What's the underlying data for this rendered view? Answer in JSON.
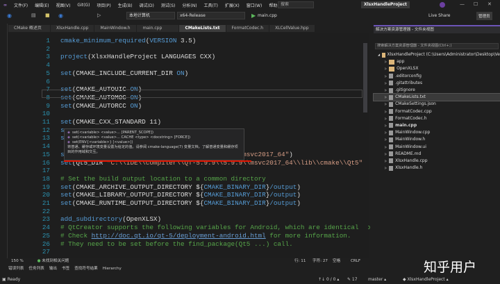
{
  "menu": [
    "文件(F)",
    "编辑(E)",
    "视图(V)",
    "Git(G)",
    "项目(P)",
    "生成(B)",
    "调试(D)",
    "测试(S)",
    "分析(N)",
    "工具(T)",
    "扩展(X)",
    "窗口(W)",
    "帮助(H)"
  ],
  "search_label": "搜索",
  "window_title": "XlsxHandleProject",
  "toolbar": {
    "target": "本地计算机",
    "config": "x64-Release",
    "run_target": "main.cpp",
    "live_share": "Live Share",
    "admin": "管理员"
  },
  "tabs": [
    "CMake 概述页",
    "XlsxHandle.cpp",
    "MainWindow.h",
    "main.cpp",
    "CMakeLists.txt",
    "FormatCodec.h",
    "XLCellValue.hpp"
  ],
  "code": [
    {
      "n": "1",
      "parts": [
        [
          "fn",
          "cmake_minimum_required"
        ],
        [
          "",
          "("
        ],
        [
          "kw",
          "VERSION"
        ],
        [
          "",
          " 3.5)"
        ]
      ]
    },
    {
      "n": "2",
      "parts": []
    },
    {
      "n": "3",
      "parts": [
        [
          "kw",
          "project"
        ],
        [
          "",
          "(XlsxHandleProject LANGUAGES CXX)"
        ]
      ]
    },
    {
      "n": "4",
      "parts": []
    },
    {
      "n": "5",
      "parts": [
        [
          "kw",
          "set"
        ],
        [
          "",
          "(CMAKE_INCLUDE_CURRENT_DIR "
        ],
        [
          "kw",
          "ON"
        ],
        [
          "",
          ")"
        ]
      ]
    },
    {
      "n": "6",
      "parts": []
    },
    {
      "n": "7",
      "parts": [
        [
          "kw",
          "set"
        ],
        [
          "",
          "(CMAKE_AUTOUIC "
        ],
        [
          "kw",
          "ON"
        ],
        [
          "",
          ")"
        ]
      ]
    },
    {
      "n": "8",
      "parts": [
        [
          "kw",
          "set"
        ],
        [
          "",
          "(CMAKE_AUTOMOC "
        ],
        [
          "kw",
          "ON"
        ],
        [
          "",
          ")"
        ]
      ]
    },
    {
      "n": "9",
      "parts": [
        [
          "kw",
          "set"
        ],
        [
          "",
          "(CMAKE_AUTORCC "
        ],
        [
          "kw",
          "ON"
        ],
        [
          "",
          ")"
        ]
      ]
    },
    {
      "n": "10",
      "parts": []
    },
    {
      "n": "11",
      "parts": [
        [
          "kw",
          "set"
        ],
        [
          "",
          "(CMAKE_CXX_STANDARD 11)"
        ]
      ]
    },
    {
      "n": "12",
      "parts": [
        [
          "kw",
          "se"
        ]
      ]
    },
    {
      "n": "13",
      "parts": [
        [
          "kw",
          "se"
        ]
      ]
    },
    {
      "n": "14",
      "parts": []
    },
    {
      "n": "15",
      "parts": [
        [
          "kw",
          "se"
        ],
        [
          "",
          "                                          "
        ],
        [
          "str",
          "9\\\\msvc2017_64\""
        ],
        [
          "",
          ")"
        ]
      ]
    },
    {
      "n": "16",
      "parts": [
        [
          "kw",
          "set"
        ],
        [
          "",
          "(Qt5_DIR "
        ],
        [
          "str",
          "\"C:\\\\IDE\\\\compiler\\\\QT-5.9.9\\\\5.9.9\\\\msvc2017_64\\\\lib\\\\cmake\\\\Qt5\""
        ],
        [
          "",
          ")"
        ]
      ]
    },
    {
      "n": "17",
      "parts": []
    },
    {
      "n": "18",
      "parts": [
        [
          "cm",
          "# Set the build output location to a common directory"
        ]
      ]
    },
    {
      "n": "19",
      "parts": [
        [
          "kw",
          "set"
        ],
        [
          "",
          "(CMAKE_ARCHIVE_OUTPUT_DIRECTORY ${"
        ],
        [
          "kw",
          "CMAKE_BINARY_DIR"
        ],
        [
          "",
          "}"
        ],
        [
          "kw",
          "/output"
        ],
        [
          "",
          ")"
        ]
      ]
    },
    {
      "n": "20",
      "parts": [
        [
          "kw",
          "set"
        ],
        [
          "",
          "(CMAKE_LIBRARY_OUTPUT_DIRECTORY ${"
        ],
        [
          "kw",
          "CMAKE_BINARY_DIR"
        ],
        [
          "",
          "}"
        ],
        [
          "kw",
          "/output"
        ],
        [
          "",
          ")"
        ]
      ]
    },
    {
      "n": "21",
      "parts": [
        [
          "kw",
          "set"
        ],
        [
          "",
          "(CMAKE_RUNTIME_OUTPUT_DIRECTORY ${"
        ],
        [
          "kw",
          "CMAKE_BINARY_DIR"
        ],
        [
          "",
          "}"
        ],
        [
          "kw",
          "/output"
        ],
        [
          "",
          ")"
        ]
      ]
    },
    {
      "n": "22",
      "parts": []
    },
    {
      "n": "23",
      "parts": [
        [
          "kw",
          "add_subdirectory"
        ],
        [
          "",
          "(OpenXLSX)"
        ]
      ]
    },
    {
      "n": "24",
      "parts": [
        [
          "cm",
          "# QtCreator supports the following variables for Android, which are identical to qmake Andr"
        ]
      ]
    },
    {
      "n": "25",
      "parts": [
        [
          "cm",
          "# Check "
        ],
        [
          "url",
          "http://doc.qt.io/qt-5/deployment-android.html"
        ],
        [
          "cm",
          " for more information."
        ]
      ]
    },
    {
      "n": "26",
      "parts": [
        [
          "cm",
          "# They need to be set before the find_package(Qt5 ...) call."
        ]
      ]
    },
    {
      "n": "27",
      "parts": []
    }
  ],
  "tooltip": {
    "sig1": "set(<variable> <value>... [PARENT_SCOPE])",
    "sig2": "set(<variable> <value>... CACHE <type> <docstring> [FORCE])",
    "sig3": "set(ENV{<variable>} [<value>])",
    "desc": "将普通、缓存或环境变量设置为给定的值。请参阅 cmake-language(7) 变量文档，了解普通变量和缓存项目的作用域和交互。"
  },
  "solution": {
    "header": "解决方案资源管理器 - 文件夹视图",
    "search_placeholder": "搜索解决方案资源管理器 - 文件夹视图(Ctrl+;)",
    "items": [
      {
        "label": "XlsxHandleProject (C:\\Users\\Administrator\\Desktop\\Ve",
        "type": "folder",
        "depth": 0
      },
      {
        "label": "app",
        "type": "folder",
        "depth": 1
      },
      {
        "label": "OpenXLSX",
        "type": "folder",
        "depth": 1
      },
      {
        "label": ".editorconfig",
        "type": "file",
        "depth": 1
      },
      {
        "label": ".gitattributes",
        "type": "file",
        "depth": 1
      },
      {
        "label": ".gitignore",
        "type": "file",
        "depth": 1
      },
      {
        "label": "CMakeLists.txt",
        "type": "file",
        "depth": 1,
        "selected": true
      },
      {
        "label": "CMakeSettings.json",
        "type": "file",
        "depth": 1
      },
      {
        "label": "FormatCodec.cpp",
        "type": "file",
        "depth": 1
      },
      {
        "label": "FormatCodec.h",
        "type": "file",
        "depth": 1
      },
      {
        "label": "main.cpp",
        "type": "file",
        "depth": 1,
        "bold": true
      },
      {
        "label": "MainWindow.cpp",
        "type": "file",
        "depth": 1
      },
      {
        "label": "MainWindow.h",
        "type": "file",
        "depth": 1
      },
      {
        "label": "MainWindow.ui",
        "type": "file",
        "depth": 1
      },
      {
        "label": "README.md",
        "type": "file",
        "depth": 1
      },
      {
        "label": "XlsxHandle.cpp",
        "type": "file",
        "depth": 1
      },
      {
        "label": "XlsxHandle.h",
        "type": "file",
        "depth": 1
      }
    ]
  },
  "editor_status": {
    "zoom": "150 %",
    "issues": "未找到相关问题",
    "line": "行: 11",
    "char": "字符: 27",
    "spaces": "空格",
    "eol": "CRLF"
  },
  "output_tabs": [
    "错误列表",
    "任务列表",
    "输出",
    "书签",
    "查找符号结果",
    "Hierarchy"
  ],
  "statusbar": {
    "ready": "Ready",
    "sync": "↑↓ 0 / 0 ▴",
    "edits": "✎ 17",
    "branch": "master ▴",
    "project": "◆ XlsxHandleProject ▴"
  },
  "watermark": "知乎用户"
}
